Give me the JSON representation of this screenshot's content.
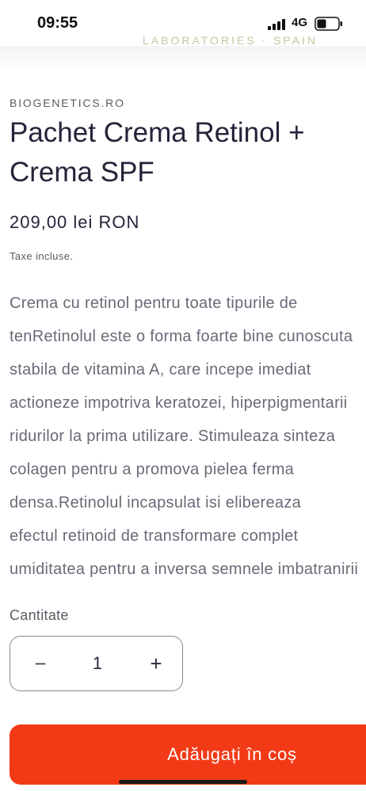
{
  "status_bar": {
    "time": "09:55",
    "network": "4G"
  },
  "header": {
    "brand_remnant": "LABORATORIES · SPAIN"
  },
  "product": {
    "vendor": "BIOGENETICS.RO",
    "title": "Pachet Crema Retinol + Crema SPF",
    "price": "209,00 lei RON",
    "tax_note": "Taxe incluse.",
    "description_lines": [
      "Crema cu retinol pentru toate tipurile de",
      "tenRetinolul este o forma foarte bine cunoscuta",
      "stabila de vitamina A, care incepe imediat",
      "actioneze impotriva keratozei, hiperpigmentarii",
      "ridurilor la prima utilizare. Stimuleaza sinteza",
      "colagen pentru a promova pielea ferma",
      "densa.Retinolul incapsulat isi elibereaza",
      "efectul retinoid de transformare complet",
      "umiditatea pentru a inversa semnele imbatranirii"
    ]
  },
  "quantity": {
    "label": "Cantitate",
    "value": "1",
    "minus_symbol": "−",
    "plus_symbol": "+"
  },
  "cart": {
    "add_label": "Adăugați în coș",
    "button_color": "#f33a17"
  },
  "icons": {
    "signal": "cellular-signal-icon",
    "battery": "battery-icon"
  }
}
